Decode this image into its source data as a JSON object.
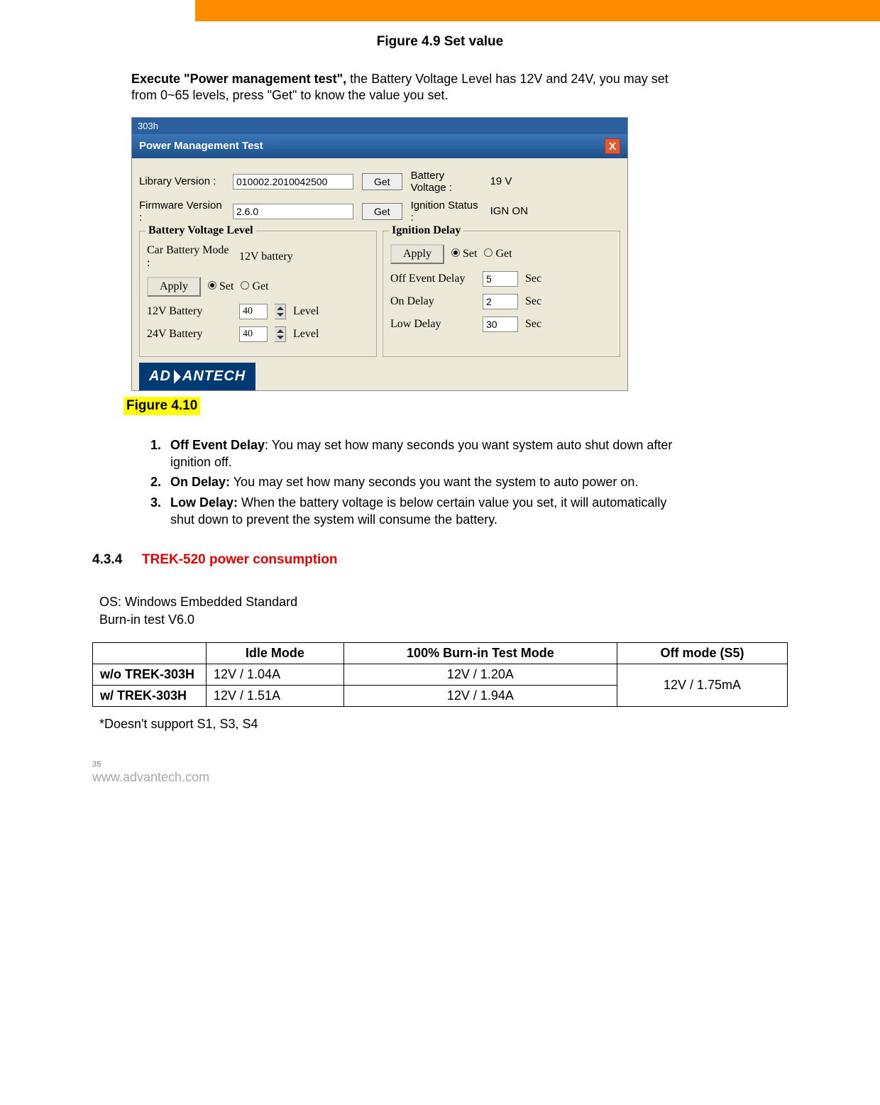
{
  "header_bar": {},
  "fig49_caption": "Figure 4.9 Set value",
  "intro": {
    "lead": "Execute \"Power management test\",",
    "rest": " the Battery Voltage Level has 12V and 24V, you may set from 0~65 levels, press \"Get\" to know the value you set."
  },
  "screenshot": {
    "app_title": "303h",
    "window_title": "Power Management Test",
    "library_version_label": "Library Version :",
    "library_version_value": "010002.2010042500",
    "firmware_version_label": "Firmware Version :",
    "firmware_version_value": "2.6.0",
    "get_btn": "Get",
    "battery_voltage_label": "Battery Voltage :",
    "battery_voltage_value": "19 V",
    "ignition_status_label": "Ignition Status :",
    "ignition_status_value": "IGN ON",
    "group_bvl": {
      "title": "Battery Voltage Level",
      "car_mode_label": "Car Battery Mode :",
      "car_mode_value": "12V battery",
      "apply_btn": "Apply",
      "set_radio": "Set",
      "get_radio": "Get",
      "v12_label": "12V Battery",
      "v12_value": "40",
      "v24_label": "24V Battery",
      "v24_value": "40",
      "level_unit": "Level"
    },
    "group_delay": {
      "title": "Ignition Delay",
      "apply_btn": "Apply",
      "set_radio": "Set",
      "get_radio": "Get",
      "off_label": "Off Event Delay",
      "off_value": "5",
      "on_label": "On Delay",
      "on_value": "2",
      "low_label": "Low Delay",
      "low_value": "30",
      "sec_unit": "Sec"
    },
    "logo_text": "AD   ANTECH"
  },
  "fig410_caption": "Figure 4.10",
  "list": {
    "i1_num": "1.",
    "i1_bold": "Off Event Delay",
    "i1_rest": ": You may set how many seconds you want system auto shut down after ignition off.",
    "i2_num": "2.",
    "i2_bold": "On Delay:",
    "i2_rest": " You may set how many seconds you want the system to auto power on.",
    "i3_num": "3.",
    "i3_bold": "Low Delay:",
    "i3_rest": " When the battery voltage is below certain value you set, it will automatically shut down to prevent the system will consume the battery."
  },
  "section_434": {
    "num": "4.3.4",
    "title": "TREK-520 power consumption"
  },
  "os_line": "OS: Windows Embedded Standard",
  "burnin_line": "Burn-in test V6.0",
  "table": {
    "h_idle": "Idle Mode",
    "h_burn": "100% Burn-in Test Mode",
    "h_off": "Off mode (S5)",
    "r1_label": "w/o TREK-303H",
    "r1_idle": "12V / 1.04A",
    "r1_burn": "12V / 1.20A",
    "r2_label": "w/ TREK-303H",
    "r2_idle": "12V / 1.51A",
    "r2_burn": "12V / 1.94A",
    "off_merged": "12V / 1.75mA"
  },
  "footnote": "*Doesn't support S1, S3, S4",
  "page_num": "35",
  "url": "www.advantech.com"
}
